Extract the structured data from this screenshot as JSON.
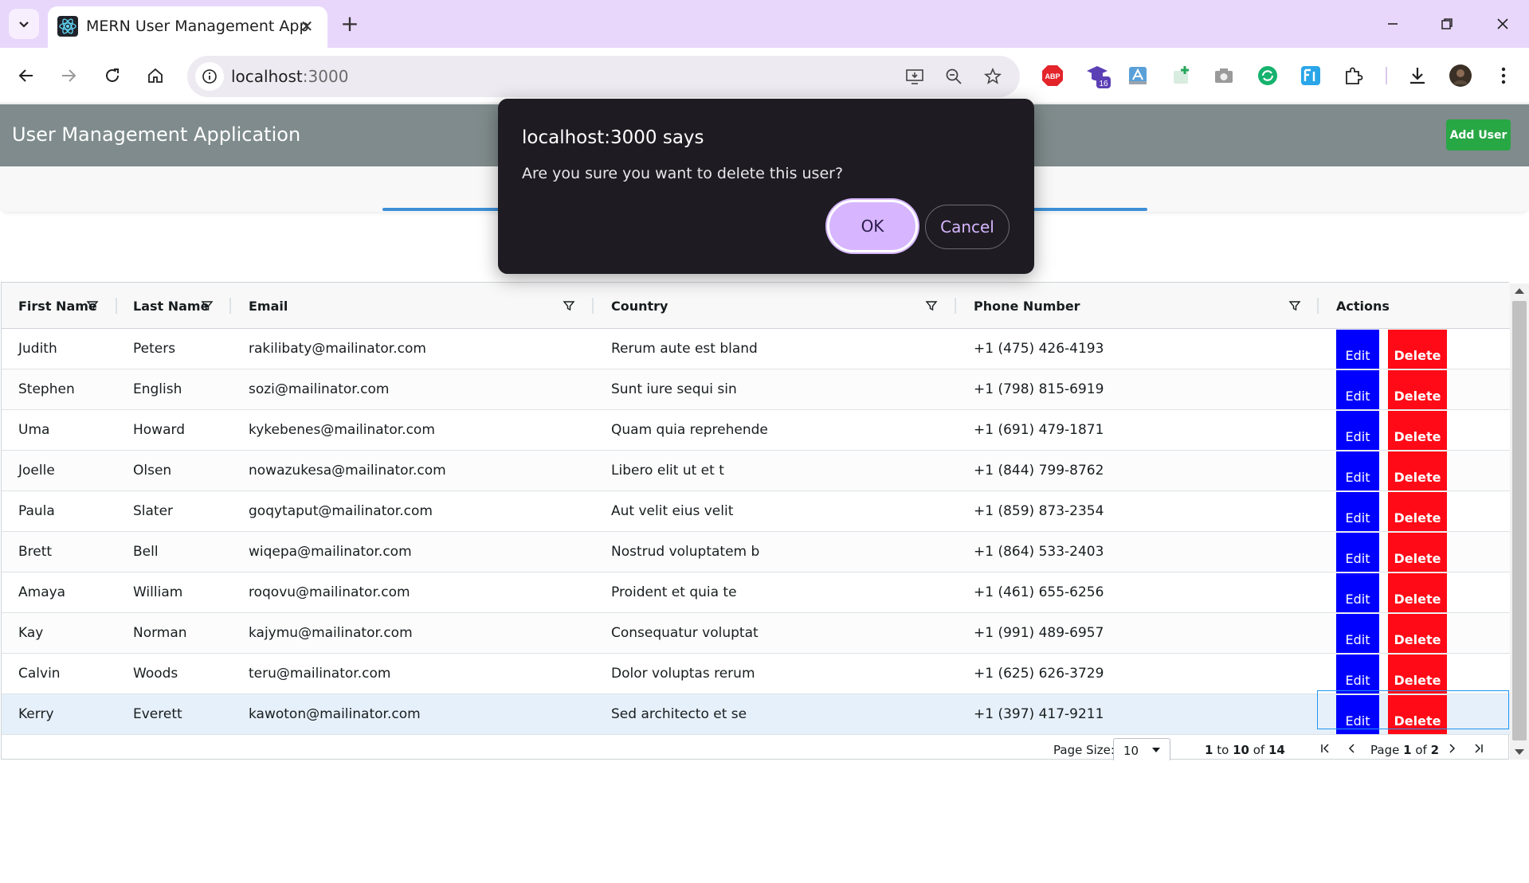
{
  "browser": {
    "tab_title": "MERN User Management App",
    "url_host": "localhost",
    "url_port": ":3000",
    "extensions": {
      "adblock_label": "ABP",
      "badge_count": "16"
    }
  },
  "app": {
    "title": "User Management Application",
    "add_user_label": "Add User"
  },
  "grid": {
    "columns": [
      {
        "key": "first_name",
        "label": "First Name"
      },
      {
        "key": "last_name",
        "label": "Last Name"
      },
      {
        "key": "email",
        "label": "Email"
      },
      {
        "key": "country",
        "label": "Country"
      },
      {
        "key": "phone",
        "label": "Phone Number"
      },
      {
        "key": "actions",
        "label": "Actions"
      }
    ],
    "edit_label": "Edit",
    "delete_label": "Delete",
    "rows": [
      {
        "first_name": "Judith",
        "last_name": "Peters",
        "email": "rakilibaty@mailinator.com",
        "country": "Rerum aute est bland",
        "phone": "+1 (475) 426-4193"
      },
      {
        "first_name": "Stephen",
        "last_name": "English",
        "email": "sozi@mailinator.com",
        "country": "Sunt iure sequi sin",
        "phone": "+1 (798) 815-6919"
      },
      {
        "first_name": "Uma",
        "last_name": "Howard",
        "email": "kykebenes@mailinator.com",
        "country": "Quam quia reprehende",
        "phone": "+1 (691) 479-1871"
      },
      {
        "first_name": "Joelle",
        "last_name": "Olsen",
        "email": "nowazukesa@mailinator.com",
        "country": "Libero elit ut et t",
        "phone": "+1 (844) 799-8762"
      },
      {
        "first_name": "Paula",
        "last_name": "Slater",
        "email": "goqytaput@mailinator.com",
        "country": "Aut velit eius velit",
        "phone": "+1 (859) 873-2354"
      },
      {
        "first_name": "Brett",
        "last_name": "Bell",
        "email": "wiqepa@mailinator.com",
        "country": "Nostrud voluptatem b",
        "phone": "+1 (864) 533-2403"
      },
      {
        "first_name": "Amaya",
        "last_name": "William",
        "email": "roqovu@mailinator.com",
        "country": "Proident et quia te",
        "phone": "+1 (461) 655-6256"
      },
      {
        "first_name": "Kay",
        "last_name": "Norman",
        "email": "kajymu@mailinator.com",
        "country": "Consequatur voluptat",
        "phone": "+1 (991) 489-6957"
      },
      {
        "first_name": "Calvin",
        "last_name": "Woods",
        "email": "teru@mailinator.com",
        "country": "Dolor voluptas rerum",
        "phone": "+1 (625) 626-3729"
      },
      {
        "first_name": "Kerry",
        "last_name": "Everett",
        "email": "kawoton@mailinator.com",
        "country": "Sed architecto et se",
        "phone": "+1 (397) 417-9211"
      }
    ],
    "selected_row_index": 9
  },
  "pagination": {
    "page_size_label": "Page Size:",
    "page_size_value": "10",
    "from": "1",
    "to_word": "to",
    "to": "10",
    "of_word": "of",
    "total": "14",
    "page_word": "Page",
    "current_page": "1",
    "page_count": "2"
  },
  "dialog": {
    "title": "localhost:3000 says",
    "message": "Are you sure you want to delete this user?",
    "ok_label": "OK",
    "cancel_label": "Cancel"
  },
  "colors": {
    "app_header": "#7f8b8c",
    "add_user": "#28a745",
    "edit_button": "#0000ff",
    "delete_button": "#ff0a16",
    "dialog_bg": "#1e1c22",
    "dialog_accent": "#d7b6ff",
    "tab_strip": "#e8d7fb"
  }
}
